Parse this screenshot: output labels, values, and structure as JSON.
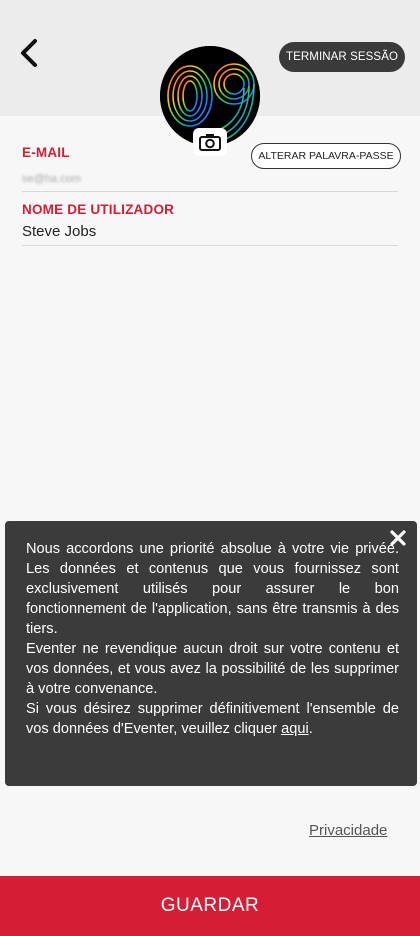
{
  "header": {
    "back_icon": "arrow-left-icon",
    "logout_label": "TERMINAR SESSÃO"
  },
  "avatar": {
    "image_text": "09",
    "camera_icon": "camera-icon"
  },
  "form": {
    "email_label": "E-MAIL",
    "email_value": "se@ha.com",
    "change_password_label": "ALTERAR PALAVRA-PASSE",
    "username_label": "NOME DE UTILIZADOR",
    "username_value": "Steve Jobs"
  },
  "privacy_tooltip": {
    "close_icon": "close-icon",
    "paragraph_1": "Nous accordons une priorité absolue à votre vie privée. Les données et contenus que vous fournissez sont exclusivement utilisés pour assurer le bon fonctionnement de l'application, sans être transmis à des tiers.",
    "paragraph_2": "Eventer ne revendique aucun droit sur votre contenu et vos données, et vous avez la possibilité de les supprimer à votre convenance.",
    "paragraph_3_prefix": "Si vous désirez supprimer définitivement l'ensemble de vos données d'Eventer, veuillez cliquer",
    "link_label": "aqui",
    "paragraph_3_suffix": "."
  },
  "privacy_link_label": "Privacidade",
  "save_button_label": "GUARDAR",
  "colors": {
    "accent": "#d51e35",
    "tooltip_bg": "#3b3b3b",
    "header_bg": "#ececec"
  }
}
